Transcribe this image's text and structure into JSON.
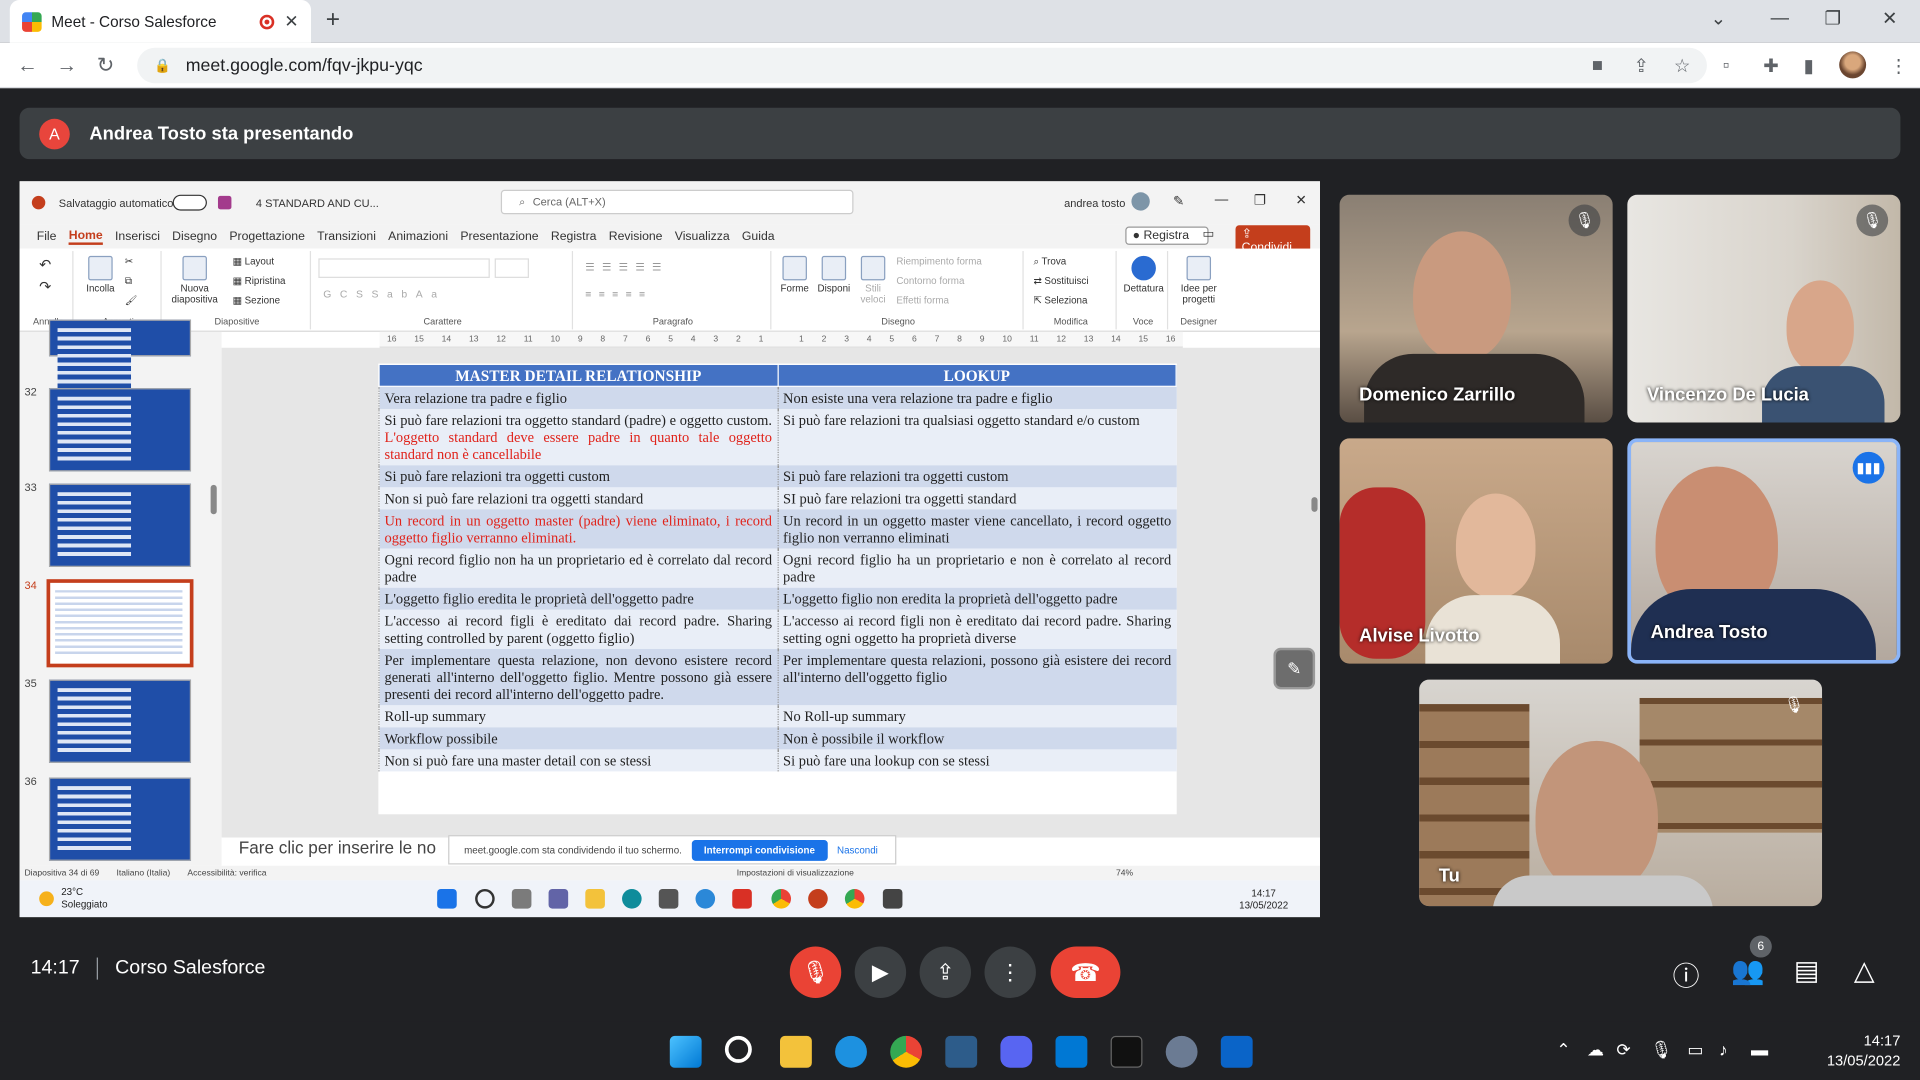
{
  "browser": {
    "tab_title": "Meet - Corso Salesforce",
    "url": "meet.google.com/fqv-jkpu-yqc"
  },
  "presenting": {
    "avatar_letter": "A",
    "text": "Andrea Tosto sta presentando"
  },
  "powerpoint": {
    "autosave_label": "Salvataggio automatico",
    "file_name": "4 STANDARD AND CU...",
    "search_placeholder": "Cerca (ALT+X)",
    "user": "andrea tosto",
    "ribbon_tabs": [
      "File",
      "Home",
      "Inserisci",
      "Disegno",
      "Progettazione",
      "Transizioni",
      "Animazioni",
      "Presentazione",
      "Registra",
      "Revisione",
      "Visualizza",
      "Guida"
    ],
    "record_button": "Registra",
    "share_button": "Condividi",
    "groups": {
      "annulla": "Annulla",
      "appunti": "Appunti",
      "diapositive": "Diapositive",
      "carattere": "Carattere",
      "paragrafo": "Paragrafo",
      "disegno": "Disegno",
      "modifica": "Modifica",
      "voce": "Voce",
      "designer": "Designer"
    },
    "buttons": {
      "incolla": "Incolla",
      "nuova_diapositiva": "Nuova diapositiva",
      "layout": "Layout",
      "ripristina": "Ripristina",
      "sezione": "Sezione",
      "forme": "Forme",
      "disponi": "Disponi",
      "stili": "Stili veloci",
      "riempimento": "Riempimento forma",
      "contorno": "Contorno forma",
      "effetti": "Effetti forma",
      "trova": "Trova",
      "sostituisci": "Sostituisci",
      "seleziona": "Seleziona",
      "dettatura": "Dettatura",
      "idee": "Idee per progetti"
    },
    "ruler": [
      "16",
      "15",
      "14",
      "13",
      "12",
      "11",
      "10",
      "9",
      "8",
      "7",
      "6",
      "5",
      "4",
      "3",
      "2",
      "1",
      "",
      "1",
      "2",
      "3",
      "4",
      "5",
      "6",
      "7",
      "8",
      "9",
      "10",
      "11",
      "12",
      "13",
      "14",
      "15",
      "16"
    ],
    "thumb_numbers": [
      "32",
      "33",
      "34",
      "35",
      "36"
    ],
    "table": {
      "headers": [
        "MASTER DETAIL RELATIONSHIP",
        "LOOKUP"
      ],
      "rows": [
        [
          "Vera relazione tra padre e figlio",
          "Non esiste una vera relazione tra padre e figlio"
        ],
        [
          "Si può fare relazioni tra oggetto standard (padre) e oggetto custom.",
          "Si può fare relazioni tra qualsiasi oggetto standard e/o custom"
        ],
        [
          "Si può fare relazioni tra oggetti custom",
          "Si può fare relazioni tra oggetti custom"
        ],
        [
          "Non si può fare relazioni tra oggetti standard",
          "SI può fare relazioni tra oggetti standard"
        ],
        [
          "Un record in un oggetto master (padre) viene eliminato, i record oggetto figlio verranno eliminati.",
          "Un record in un oggetto master viene cancellato, i record oggetto figlio non verranno eliminati"
        ],
        [
          "Ogni record figlio non ha un proprietario ed è correlato dal record padre",
          "Ogni record figlio ha un proprietario e non è correlato al record padre"
        ],
        [
          "L'oggetto figlio eredita le proprietà dell'oggetto padre",
          "L'oggetto figlio non eredita la proprietà dell'oggetto padre"
        ],
        [
          "L'accesso ai record figli è ereditato dai record padre. Sharing setting controlled by parent (oggetto figlio)",
          "L'accesso ai record figli non è ereditato dai record padre. Sharing setting ogni oggetto ha proprietà diverse"
        ],
        [
          "Per implementare questa relazione, non devono esistere record generati all'interno dell'oggetto figlio. Mentre possono già essere presenti dei record all'interno dell'oggetto padre.",
          "Per implementare questa relazioni, possono già esistere dei record all'interno dell'oggetto figlio"
        ],
        [
          "Roll-up summary",
          "No Roll-up summary"
        ],
        [
          "Workflow possibile",
          "Non è possibile il workflow"
        ],
        [
          "Non si può fare una master detail con se stessi",
          "Si può fare una lookup con se stessi"
        ]
      ],
      "row2_red_suffix": " L'oggetto standard deve essere padre in quanto tale oggetto standard non è cancellabile"
    },
    "notes_placeholder": "Fare clic per inserire le no",
    "share_banner": {
      "text": "meet.google.com sta condividendo il tuo schermo.",
      "stop": "Interrompi condivisione",
      "hide": "Nascondi"
    },
    "status": {
      "slide": "Diapositiva 34 di 69",
      "lang": "Italiano (Italia)",
      "access": "Accessibilità: verifica",
      "view": "Impostazioni di visualizzazione",
      "zoom": "74%"
    },
    "taskbar": {
      "temp": "23°C",
      "weather": "Soleggiato",
      "time": "14:17",
      "date": "13/05/2022"
    }
  },
  "participants": [
    {
      "name": "Domenico Zarrillo"
    },
    {
      "name": "Vincenzo De Lucia"
    },
    {
      "name": "Alvise Livotto"
    },
    {
      "name": "Andrea Tosto"
    },
    {
      "name": "Tu"
    }
  ],
  "meeting": {
    "time": "14:17",
    "name": "Corso Salesforce",
    "participants_count": "6"
  },
  "os": {
    "time": "14:17",
    "date": "13/05/2022"
  },
  "colors": {
    "meet_bg": "#202124",
    "table_header": "#4472c4",
    "hangup": "#ea4335",
    "active_speaker": "#1a73e8",
    "accent_red_text": "#e0231b"
  }
}
